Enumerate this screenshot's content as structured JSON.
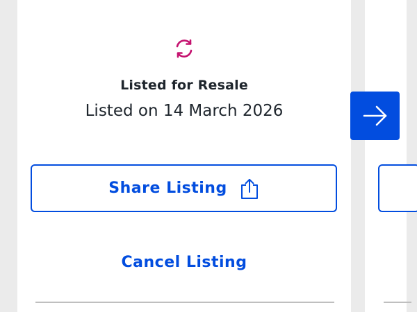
{
  "listing": {
    "status_icon": "resale-sync-icon",
    "status_title": "Listed for Resale",
    "status_date": "Listed on 14 March 2026",
    "share_label": "Share Listing",
    "share_icon": "share-upload-icon",
    "cancel_label": "Cancel Listing"
  },
  "carousel": {
    "next_icon": "arrow-right-icon"
  },
  "colors": {
    "accent": "#024ddf",
    "status_icon": "#c4126f",
    "text": "#1f262d",
    "divider": "#bfbfbf",
    "background": "#ebebeb"
  }
}
